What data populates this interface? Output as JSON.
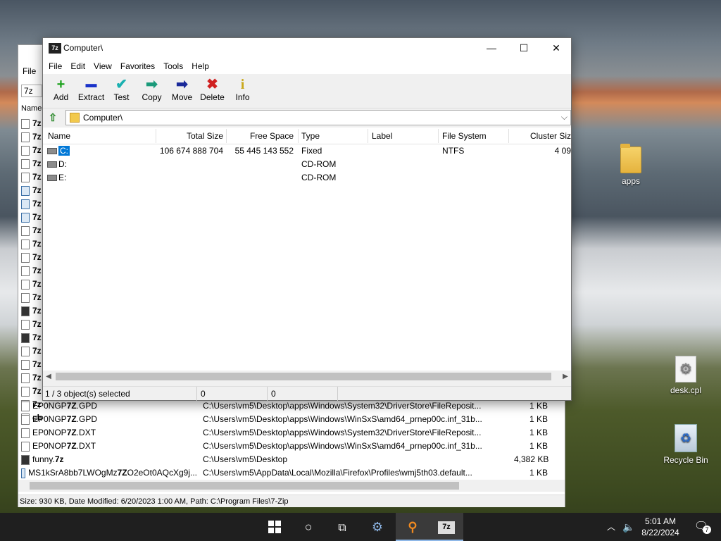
{
  "desktop": {
    "icons": [
      {
        "label": "apps"
      },
      {
        "label": "desk.cpl"
      },
      {
        "label": "Recycle Bin"
      }
    ]
  },
  "bg_window": {
    "menu_file": "File",
    "address": "7z",
    "col_name": "Name",
    "left_items": [
      "7z",
      "7z",
      "7z",
      "7z",
      "7z",
      "7z",
      "7z",
      "7z",
      "7z",
      "7z",
      "7z",
      "7z",
      "7z",
      "7z",
      "7z",
      "7z",
      "7z",
      "7z",
      "7z",
      "7z",
      "7z",
      "7z",
      "ch"
    ],
    "rows": [
      {
        "name_pre": "EP0NGP",
        "name_bold": "7Z",
        "name_post": ".GPD",
        "path": "C:\\Users\\vm5\\Desktop\\apps\\Windows\\System32\\DriverStore\\FileReposit...",
        "size": "1 KB"
      },
      {
        "name_pre": "EP0NGP",
        "name_bold": "7Z",
        "name_post": ".GPD",
        "path": "C:\\Users\\vm5\\Desktop\\apps\\Windows\\WinSxS\\amd64_prnep00c.inf_31b...",
        "size": "1 KB"
      },
      {
        "name_pre": "EP0NOP",
        "name_bold": "7Z",
        "name_post": ".DXT",
        "path": "C:\\Users\\vm5\\Desktop\\apps\\Windows\\System32\\DriverStore\\FileReposit...",
        "size": "1 KB"
      },
      {
        "name_pre": "EP0NOP",
        "name_bold": "7Z",
        "name_post": ".DXT",
        "path": "C:\\Users\\vm5\\Desktop\\apps\\Windows\\WinSxS\\amd64_prnep00c.inf_31b...",
        "size": "1 KB"
      },
      {
        "name_pre": "funny.",
        "name_bold": "7z",
        "name_post": "",
        "path": "C:\\Users\\vm5\\Desktop",
        "size": "4,382 KB"
      },
      {
        "name_pre": "MS1kSrA8bb7LWOgMz",
        "name_bold": "7Z",
        "name_post": "O2eOt0AQcXg9j...",
        "path": "C:\\Users\\vm5\\AppData\\Local\\Mozilla\\Firefox\\Profiles\\wmj5th03.default...",
        "size": "1 KB"
      }
    ],
    "status": "Size: 930 KB, Date Modified: 6/20/2023 1:00 AM, Path: C:\\Program Files\\7-Zip"
  },
  "window": {
    "logo": "7z",
    "title": "Computer\\",
    "controls": {
      "minimize": "—",
      "maximize": "☐",
      "close": "✕"
    },
    "menu": [
      "File",
      "Edit",
      "View",
      "Favorites",
      "Tools",
      "Help"
    ],
    "toolbar": [
      {
        "label": "Add",
        "icon": "+",
        "color": "#1aa11a"
      },
      {
        "label": "Extract",
        "icon": "▬",
        "color": "#1a33c9"
      },
      {
        "label": "Test",
        "icon": "✔",
        "color": "#1ab0b0"
      },
      {
        "label": "Copy",
        "icon": "➡",
        "color": "#1a9a7a"
      },
      {
        "label": "Move",
        "icon": "➡",
        "color": "#1a2a9a"
      },
      {
        "label": "Delete",
        "icon": "✖",
        "color": "#d02020"
      },
      {
        "label": "Info",
        "icon": "i",
        "color": "#c9a81a"
      }
    ],
    "address": "Computer\\",
    "columns": [
      "Name",
      "Total Size",
      "Free Space",
      "Type",
      "Label",
      "File System",
      "Cluster Siz"
    ],
    "drives": [
      {
        "name": "C:",
        "total": "106 674 888 704",
        "free": "55 445 143 552",
        "type": "Fixed",
        "label": "",
        "fs": "NTFS",
        "cluster": "4 09"
      },
      {
        "name": "D:",
        "total": "",
        "free": "",
        "type": "CD-ROM",
        "label": "",
        "fs": "",
        "cluster": ""
      },
      {
        "name": "E:",
        "total": "",
        "free": "",
        "type": "CD-ROM",
        "label": "",
        "fs": "",
        "cluster": ""
      }
    ],
    "status": {
      "selected": "1 / 3 object(s) selected",
      "size": "0",
      "packed": "0"
    }
  },
  "taskbar": {
    "time": "5:01 AM",
    "date": "8/22/2024",
    "notification_count": "7"
  }
}
